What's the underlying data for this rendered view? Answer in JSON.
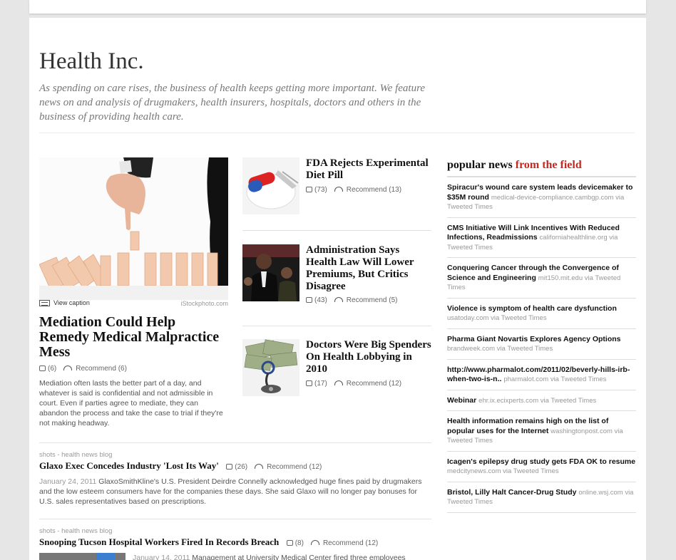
{
  "page": {
    "title": "Health Inc.",
    "description": "As spending on care rises, the business of health keeps getting more important. We feature news on and analysis of drugmakers, health insurers, hospitals, doctors and others in the business of providing health care."
  },
  "lead": {
    "caption_label": "View caption",
    "credit": "iStockphoto.com",
    "headline": "Mediation Could Help Remedy Medical Malpractice Mess",
    "comments": "(6)",
    "recommend": "Recommend (6)",
    "body": "Mediation often lasts the better part of a day, and whatever is said is confidential and not admissible in court. Even if parties agree to mediate, they can abandon the process and take the case to trial if they're not making headway."
  },
  "stories": [
    {
      "headline": "FDA Rejects Experimental Diet Pill",
      "comments": "(73)",
      "recommend": "Recommend (13)"
    },
    {
      "headline": "Administration Says Health Law Will Lower Premiums, But Critics Disagree",
      "comments": "(43)",
      "recommend": "Recommend (5)"
    },
    {
      "headline": "Doctors Were Big Spenders On Health Lobbying in 2010",
      "comments": "(17)",
      "recommend": "Recommend (12)"
    }
  ],
  "blog": [
    {
      "tag": "shots - health news blog",
      "headline": "Glaxo Exec Concedes Industry 'Lost Its Way'",
      "comments": "(26)",
      "recommend": "Recommend (12)",
      "date": "January 24, 2011",
      "body": "GlaxoSmithKline's U.S. President Deirdre Connelly acknowledged huge fines paid by drugmakers and the low esteem consumers have for the companies these days. She said Glaxo will no longer pay bonuses for U.S. sales representatives based on prescriptions."
    },
    {
      "tag": "shots - health news blog",
      "headline": "Snooping Tucson Hospital Workers Fired In Records Breach",
      "comments": "(8)",
      "recommend": "Recommend (12)",
      "date": "January 14, 2011",
      "body": "Management at University Medical Center fired three employees"
    }
  ],
  "sidebar": {
    "heading_main": "popular news",
    "heading_accent": "from the field",
    "items": [
      {
        "title": "Spiracur's wound care system leads devicemaker to $35M round",
        "source": "medical-device-compliance.cambgp.com via Tweeted Times"
      },
      {
        "title": "CMS Initiative Will Link Incentives With Reduced Infections, Readmissions",
        "source": "californiahealthline.org via Tweeted Times"
      },
      {
        "title": "Conquering Cancer through the Convergence of Science and Engineering",
        "source": "mit150.mit.edu via Tweeted Times"
      },
      {
        "title": "Violence is symptom of health care dysfunction",
        "source": "usatoday.com via Tweeted Times"
      },
      {
        "title": "Pharma Giant Novartis Explores Agency Options",
        "source": "brandweek.com via Tweeted Times"
      },
      {
        "title": "http://www.pharmalot.com/2011/02/beverly-hills-irb-when-two-is-n..",
        "source": "pharmalot.com via Tweeted Times"
      },
      {
        "title": "Webinar",
        "source": "ehr.ix.ecixperts.com via Tweeted Times"
      },
      {
        "title": "Health information remains high on the list of popular uses for the Internet",
        "source": "washingtonpost.com via Tweeted Times"
      },
      {
        "title": "Icagen's epilepsy drug study gets FDA OK to resume",
        "source": "medcitynews.com via Tweeted Times"
      },
      {
        "title": "Bristol, Lilly Halt Cancer-Drug Study",
        "source": "online.wsj.com via Tweeted Times"
      }
    ]
  }
}
